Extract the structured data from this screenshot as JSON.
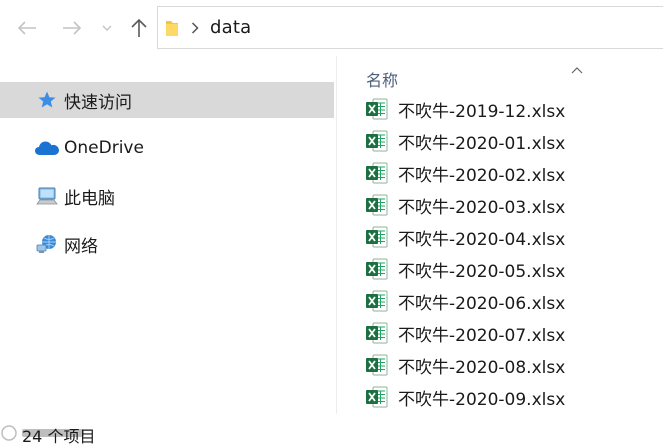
{
  "nav": {
    "back_icon": "arrow-left-icon",
    "forward_icon": "arrow-right-icon",
    "recent_icon": "chevron-down-icon",
    "up_icon": "arrow-up-icon"
  },
  "address": {
    "folder_icon": "folder-icon",
    "chevron_icon": "chevron-right-icon",
    "path": "data"
  },
  "sidebar": {
    "items": [
      {
        "label": "快速访问",
        "icon": "star-pin-icon",
        "selected": true
      },
      {
        "label": "OneDrive",
        "icon": "cloud-icon",
        "selected": false
      },
      {
        "label": "此电脑",
        "icon": "computer-icon",
        "selected": false
      },
      {
        "label": "网络",
        "icon": "network-icon",
        "selected": false
      }
    ]
  },
  "file_list": {
    "column_header": "名称",
    "sort_icon": "sort-ascending-icon",
    "file_icon": "excel-file-icon",
    "files": [
      {
        "name": "不吹牛-2019-12.xlsx"
      },
      {
        "name": "不吹牛-2020-01.xlsx"
      },
      {
        "name": "不吹牛-2020-02.xlsx"
      },
      {
        "name": "不吹牛-2020-03.xlsx"
      },
      {
        "name": "不吹牛-2020-04.xlsx"
      },
      {
        "name": "不吹牛-2020-05.xlsx"
      },
      {
        "name": "不吹牛-2020-06.xlsx"
      },
      {
        "name": "不吹牛-2020-07.xlsx"
      },
      {
        "name": "不吹牛-2020-08.xlsx"
      },
      {
        "name": "不吹牛-2020-09.xlsx"
      }
    ]
  },
  "status": {
    "item_count": "24 个项目"
  },
  "colors": {
    "selected_bg": "#d9d9d9",
    "header_text": "#4c607a",
    "excel_green": "#1d6f42",
    "folder_yellow": "#f4c542",
    "onedrive_blue": "#1a73d0"
  }
}
